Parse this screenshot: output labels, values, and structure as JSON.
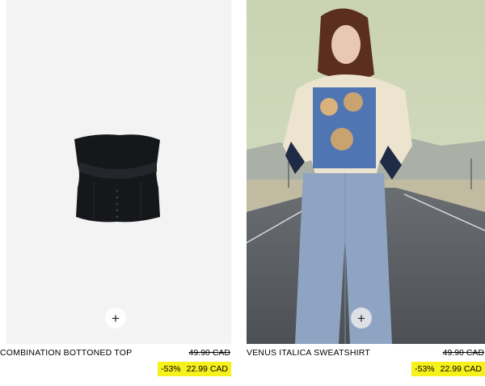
{
  "products": [
    {
      "name": "COMBINATION BOTTONED TOP",
      "old_price": "49.90 CAD",
      "discount": "-53%",
      "sale_price": "22.99 CAD",
      "add_label": "+",
      "image_icon": "black-bandeau-top-photo"
    },
    {
      "name": "VENUS ITALICA SWEATSHIRT",
      "old_price": "49.90 CAD",
      "discount": "-53%",
      "sale_price": "22.99 CAD",
      "add_label": "+",
      "image_icon": "model-on-road-photo"
    }
  ],
  "colors": {
    "sale_highlight": "#f6f01d",
    "background_card": "#f3f3f3"
  }
}
